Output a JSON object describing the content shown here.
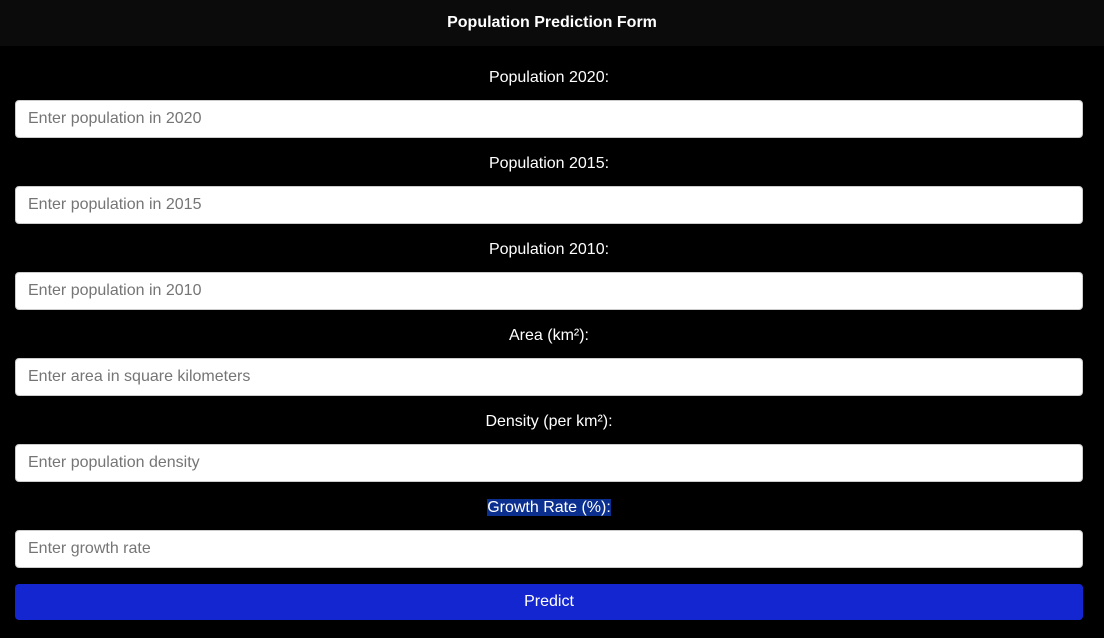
{
  "header": {
    "title": "Population Prediction Form"
  },
  "fields": [
    {
      "label": "Population 2020:",
      "placeholder": "Enter population in 2020",
      "value": ""
    },
    {
      "label": "Population 2015:",
      "placeholder": "Enter population in 2015",
      "value": ""
    },
    {
      "label": "Population 2010:",
      "placeholder": "Enter population in 2010",
      "value": ""
    },
    {
      "label": "Area (km²):",
      "placeholder": "Enter area in square kilometers",
      "value": ""
    },
    {
      "label": "Density (per km²):",
      "placeholder": "Enter population density",
      "value": ""
    },
    {
      "label": "Growth Rate (%):",
      "placeholder": "Enter growth rate",
      "value": ""
    }
  ],
  "submit": {
    "label": "Predict"
  },
  "colors": {
    "background": "#000000",
    "header_background": "#0b0b0b",
    "button": "#1426cf",
    "selection_highlight": "#0a2f8f"
  }
}
